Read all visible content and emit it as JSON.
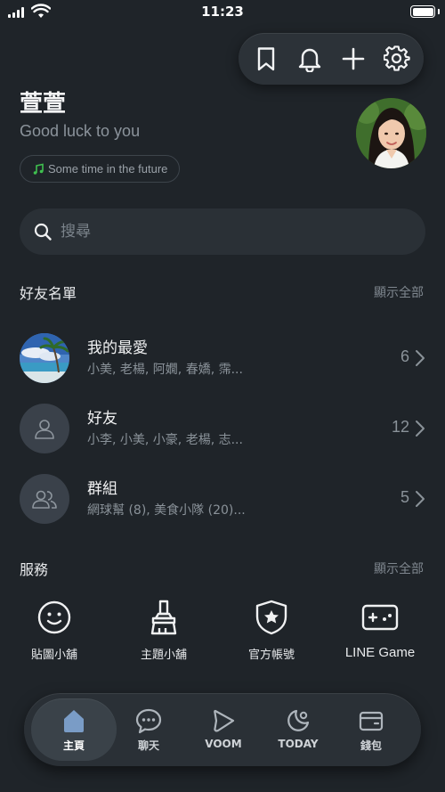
{
  "status_bar": {
    "time": "11:23",
    "battery_level": 1.0
  },
  "toolbar": {
    "icons": [
      "bookmark-icon",
      "bell-icon",
      "plus-icon",
      "gear-icon"
    ]
  },
  "profile": {
    "name": "萱萱",
    "status_message": "Good luck to you",
    "music": "Some time in the future"
  },
  "search": {
    "placeholder": "搜尋"
  },
  "friends_section": {
    "title": "好友名單",
    "see_all": "顯示全部",
    "rows": [
      {
        "title": "我的最愛",
        "subtitle": "小美, 老楊, 阿嫺, 春嬌, 霈...",
        "count": "6"
      },
      {
        "title": "好友",
        "subtitle": "小李, 小美, 小豪, 老楊, 志...",
        "count": "12"
      },
      {
        "title": "群組",
        "subtitle": "網球幫 (8), 美食小隊 (20)...",
        "count": "5"
      }
    ]
  },
  "services_section": {
    "title": "服務",
    "see_all": "顯示全部",
    "items": [
      {
        "label": "貼圖小舖",
        "icon": "smiley-icon"
      },
      {
        "label": "主題小舖",
        "icon": "paint-brush-icon"
      },
      {
        "label": "官方帳號",
        "icon": "shield-star-icon"
      },
      {
        "label": "LINE Game",
        "icon": "gamepad-icon"
      }
    ]
  },
  "bottom_nav": {
    "items": [
      {
        "label": "主頁",
        "icon": "home-icon",
        "active": true
      },
      {
        "label": "聊天",
        "icon": "chat-icon",
        "active": false
      },
      {
        "label": "VOOM",
        "icon": "voom-play-icon",
        "active": false
      },
      {
        "label": "TODAY",
        "icon": "today-icon",
        "active": false
      },
      {
        "label": "錢包",
        "icon": "wallet-icon",
        "active": false
      }
    ]
  },
  "colors": {
    "background": "#1f2429",
    "surface": "#2a3036",
    "music_note": "#3fbf4f",
    "active_nav_icon": "#7a9cc6"
  }
}
